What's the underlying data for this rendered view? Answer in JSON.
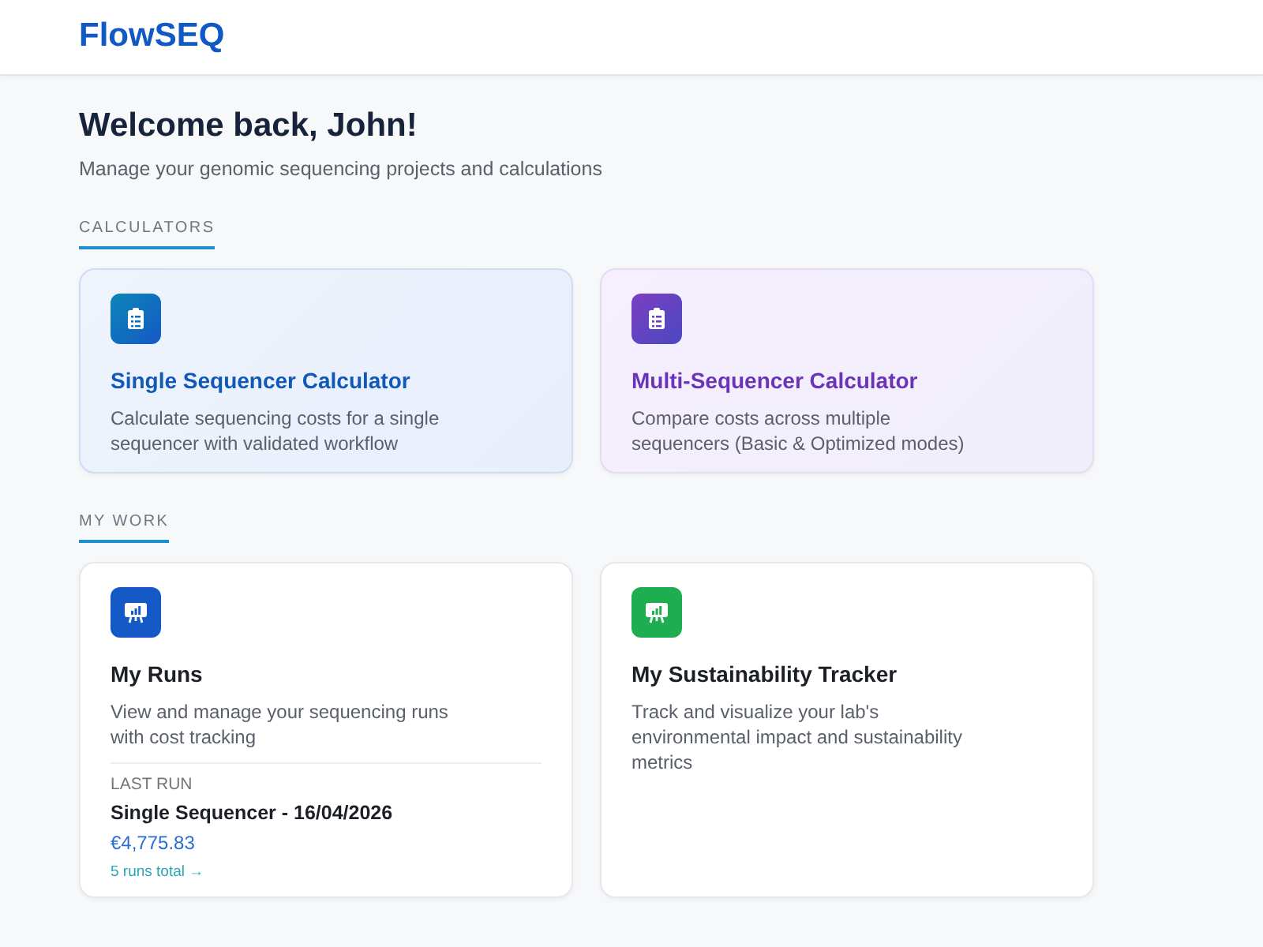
{
  "header": {
    "logo": "FlowSEQ"
  },
  "welcome": {
    "title": "Welcome back, John!",
    "subtitle": "Manage your genomic sequencing projects and calculations"
  },
  "sections": [
    {
      "label": "CALCULATORS",
      "cards": [
        {
          "kind": "single",
          "title": "Single Sequencer Calculator",
          "description": "Calculate sequencing costs for a single sequencer with validated workflow"
        },
        {
          "kind": "multi",
          "title": "Multi-Sequencer Calculator",
          "description": "Compare costs across multiple sequencers (Basic & Optimized modes)"
        }
      ]
    },
    {
      "label": "MY WORK",
      "cards": [
        {
          "kind": "runs",
          "title": "My Runs",
          "description": "View and manage your sequencing runs with cost tracking",
          "last_run": {
            "label": "LAST RUN",
            "name": "Single Sequencer - 16/04/2026",
            "cost": "€4,775.83",
            "link": "5 runs total →"
          }
        },
        {
          "kind": "sustainability",
          "title": "My Sustainability Tracker",
          "description": "Track and visualize your lab's environmental impact and sustainability metrics"
        }
      ]
    }
  ]
}
